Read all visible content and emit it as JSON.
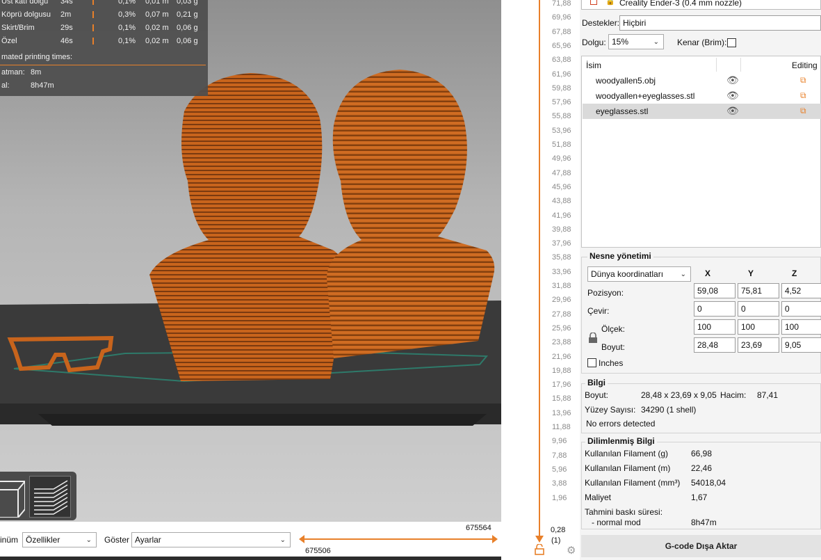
{
  "stats": {
    "rows": [
      {
        "name": "Üst katı dolgu",
        "time": "34s",
        "pct": "0,1%",
        "length": "0,01 m",
        "weight": "0,03 g"
      },
      {
        "name": "Köprü dolgusu",
        "time": "2m",
        "pct": "0,3%",
        "length": "0,07 m",
        "weight": "0,21 g"
      },
      {
        "name": "Skirt/Brim",
        "time": "29s",
        "pct": "0,1%",
        "length": "0,02 m",
        "weight": "0,06 g"
      },
      {
        "name": "Özel",
        "time": "46s",
        "pct": "0,1%",
        "length": "0,02 m",
        "weight": "0,06 g"
      }
    ],
    "estimated_header": "mated printing times:",
    "first_layer_label": "atman:",
    "first_layer_value": "8m",
    "total_label": "al:",
    "total_value": "8h47m",
    "accent": "#e8802a"
  },
  "bottombar": {
    "view_label": "inüm",
    "view_value": "Özellikler",
    "show_label": "Göster",
    "show_value": "Ayarlar",
    "hslider_right_value": "675564",
    "hslider_left_value": "675506"
  },
  "vslider": {
    "ticks": [
      "71,88",
      "69,96",
      "67,88",
      "65,96",
      "63,88",
      "61,96",
      "59,88",
      "57,96",
      "55,88",
      "53,96",
      "51,88",
      "49,96",
      "47,88",
      "45,96",
      "43,88",
      "41,96",
      "39,88",
      "37,96",
      "35,88",
      "33,96",
      "31,88",
      "29,96",
      "27,88",
      "25,96",
      "23,88",
      "21,96",
      "19,88",
      "17,96",
      "15,88",
      "13,96",
      "11,88",
      "9,96",
      "7,88",
      "5,96",
      "3,88",
      "1,96"
    ],
    "bottom_value": "0,28",
    "bottom_layer": "(1)",
    "accent": "#e8802a"
  },
  "panel": {
    "printer": "Creality Ender-3 (0.4 mm nozzle)",
    "supports_label": "Destekler:",
    "supports_value": "Hiçbiri",
    "infill_label": "Dolgu:",
    "infill_value": "15%",
    "brim_label": "Kenar (Brim):",
    "list_header_name": "İsim",
    "list_header_editing": "Editing",
    "objects": [
      {
        "name": "woodyallen5.obj"
      },
      {
        "name": "woodyallen+eyeglasses.stl"
      },
      {
        "name": "eyeglasses.stl"
      }
    ],
    "manip": {
      "title": "Nesne yönetimi",
      "coord_value": "Dünya koordinatları",
      "col_x": "X",
      "col_y": "Y",
      "col_z": "Z",
      "position_label": "Pozisyon:",
      "position": [
        "59,08",
        "75,81",
        "4,52"
      ],
      "rotate_label": "Çevir:",
      "rotate": [
        "0",
        "0",
        "0"
      ],
      "scale_label": "Ölçek:",
      "scale": [
        "100",
        "100",
        "100"
      ],
      "size_label": "Boyut:",
      "size": [
        "28,48",
        "23,69",
        "9,05"
      ],
      "inches_label": "Inches"
    },
    "info": {
      "title": "Bilgi",
      "size_label": "Boyut:",
      "size_value": "28,48 x 23,69 x 9,05",
      "volume_label": "Hacim:",
      "volume_value": "87,41",
      "facets_label": "Yüzey Sayısı:",
      "facets_value": "34290 (1 shell)",
      "errors": "No errors detected"
    },
    "sliced": {
      "title": "Dilimlenmiş Bilgi",
      "rows": [
        {
          "label": "Kullanılan Filament (g)",
          "value": "66,98"
        },
        {
          "label": "Kullanılan Filament (m)",
          "value": "22,46"
        },
        {
          "label": "Kullanılan Filament (mm³)",
          "value": "54018,04"
        },
        {
          "label": "Maliyet",
          "value": "1,67"
        }
      ],
      "estimated_label": "Tahmini baskı süresi:",
      "normal_label": "- normal mod",
      "normal_value": "8h47m"
    },
    "export_button": "G-code Dışa Aktar"
  }
}
